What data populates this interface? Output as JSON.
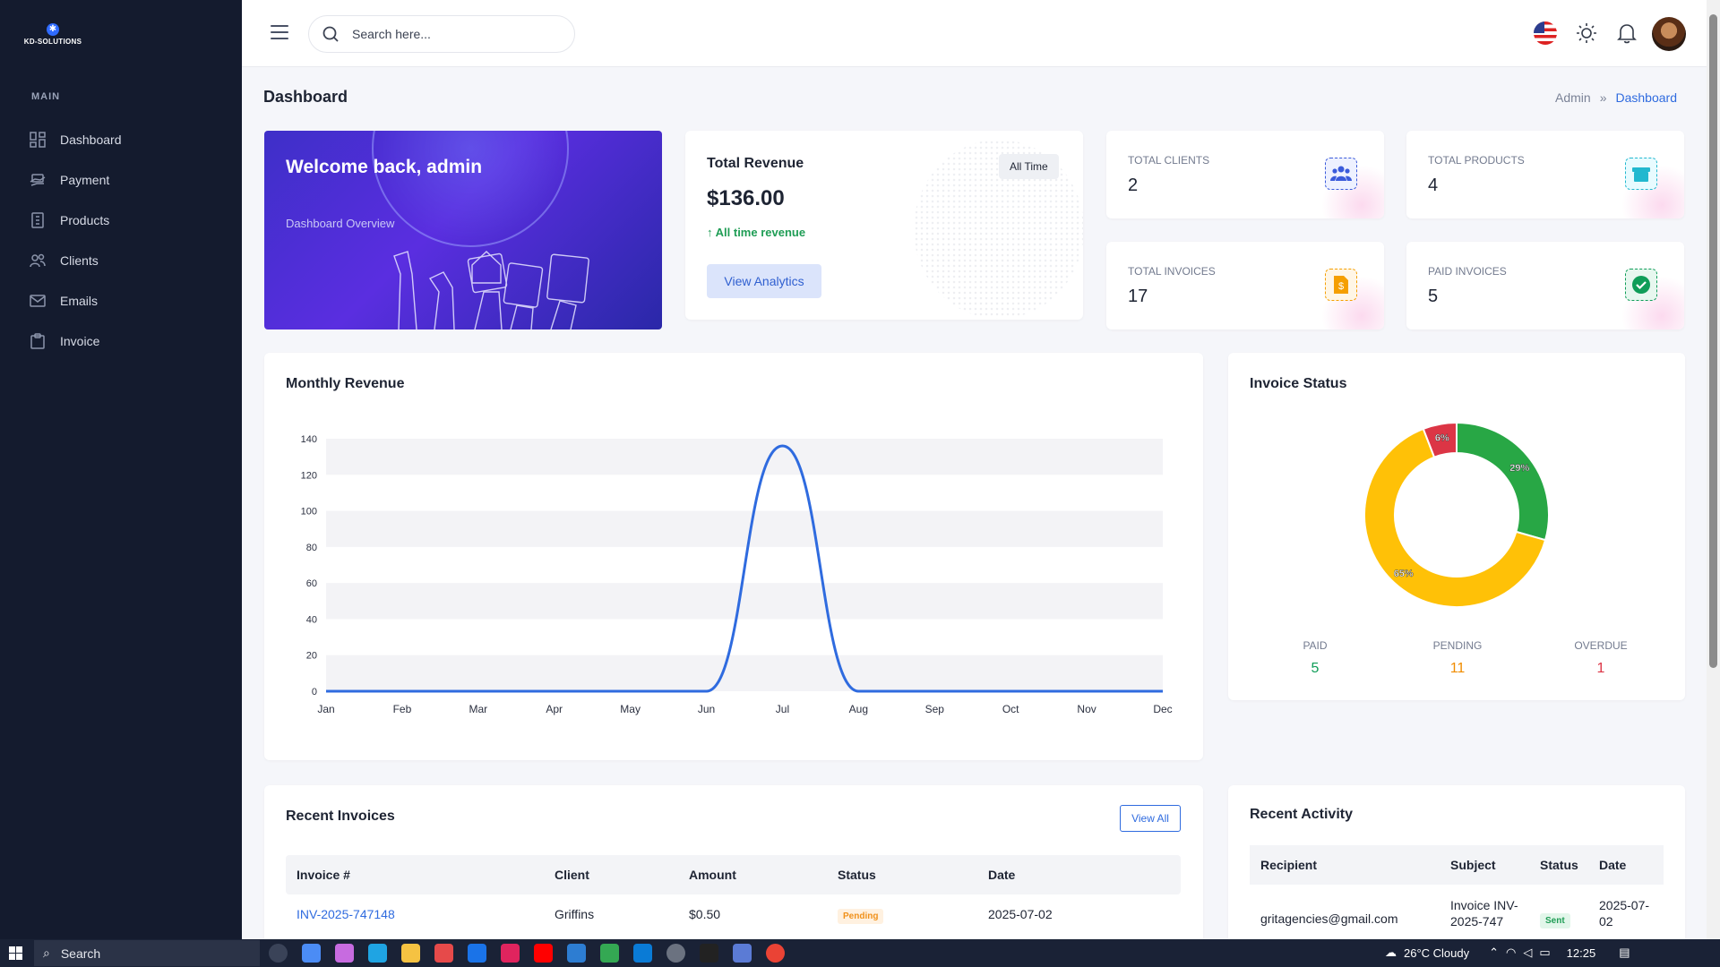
{
  "brand": {
    "name": "KD-SOLUTIONS"
  },
  "sidebar": {
    "section": "MAIN",
    "items": [
      {
        "label": "Dashboard",
        "icon": "grid-icon"
      },
      {
        "label": "Payment",
        "icon": "payment-icon"
      },
      {
        "label": "Products",
        "icon": "products-icon"
      },
      {
        "label": "Clients",
        "icon": "users-icon"
      },
      {
        "label": "Emails",
        "icon": "mail-icon"
      },
      {
        "label": "Invoice",
        "icon": "clipboard-icon"
      }
    ]
  },
  "header": {
    "search_placeholder": "Search here..."
  },
  "page": {
    "title": "Dashboard",
    "breadcrumb": [
      "Admin",
      "Dashboard"
    ]
  },
  "welcome": {
    "title": "Welcome back, admin",
    "subtitle": "Dashboard Overview"
  },
  "revenue": {
    "title": "Total Revenue",
    "filter": "All Time",
    "amount": "$136.00",
    "note": "All time revenue",
    "button": "View Analytics"
  },
  "stats": [
    {
      "label": "TOTAL CLIENTS",
      "value": "2",
      "icon": "users-icon",
      "color": "#3b5bdb"
    },
    {
      "label": "TOTAL PRODUCTS",
      "value": "4",
      "icon": "box-icon",
      "color": "#22b8cf"
    },
    {
      "label": "TOTAL INVOICES",
      "value": "17",
      "icon": "dollar-file-icon",
      "color": "#f59f00"
    },
    {
      "label": "PAID INVOICES",
      "value": "5",
      "icon": "check-circle-icon",
      "color": "#0f9d58"
    }
  ],
  "monthly": {
    "title": "Monthly Revenue"
  },
  "chart_data": [
    {
      "type": "line",
      "title": "Monthly Revenue",
      "categories": [
        "Jan",
        "Feb",
        "Mar",
        "Apr",
        "May",
        "Jun",
        "Jul",
        "Aug",
        "Sep",
        "Oct",
        "Nov",
        "Dec"
      ],
      "values": [
        0,
        0,
        0,
        0,
        0,
        0,
        136,
        0,
        0,
        0,
        0,
        0
      ],
      "yticks": [
        "0",
        "20",
        "40",
        "60",
        "80",
        "100",
        "120",
        "140"
      ],
      "ylim": [
        0,
        140
      ],
      "color": "#2f6bdf",
      "grid": "banded"
    },
    {
      "type": "pie",
      "title": "Invoice Status",
      "categories": [
        "PAID",
        "PENDING",
        "OVERDUE"
      ],
      "values": [
        5,
        11,
        1
      ],
      "labels": [
        "29%",
        "65%",
        "6%"
      ],
      "colors": [
        "#28a745",
        "#ffc107",
        "#dc3545"
      ]
    }
  ],
  "status": {
    "title": "Invoice Status",
    "legend": [
      {
        "label": "PAID",
        "value": "5",
        "color": "#0f9d58"
      },
      {
        "label": "PENDING",
        "value": "11",
        "color": "#f08c00"
      },
      {
        "label": "OVERDUE",
        "value": "1",
        "color": "#dc3545"
      }
    ]
  },
  "invoices": {
    "title": "Recent Invoices",
    "view_all": "View All",
    "columns": [
      "Invoice #",
      "Client",
      "Amount",
      "Status",
      "Date"
    ],
    "rows": [
      {
        "id": "INV-2025-747148",
        "client": "Griffins",
        "amount": "$0.50",
        "status": "Pending",
        "date": "2025-07-02"
      }
    ]
  },
  "activity": {
    "title": "Recent Activity",
    "columns": [
      "Recipient",
      "Subject",
      "Status",
      "Date"
    ],
    "rows": [
      {
        "recipient": "gritagencies@gmail.com",
        "subject": "Invoice INV-2025-747",
        "status": "Sent",
        "date": "2025-07-02"
      }
    ]
  },
  "taskbar": {
    "search": "Search",
    "weather": "26°C  Cloudy",
    "time": "12:25"
  }
}
